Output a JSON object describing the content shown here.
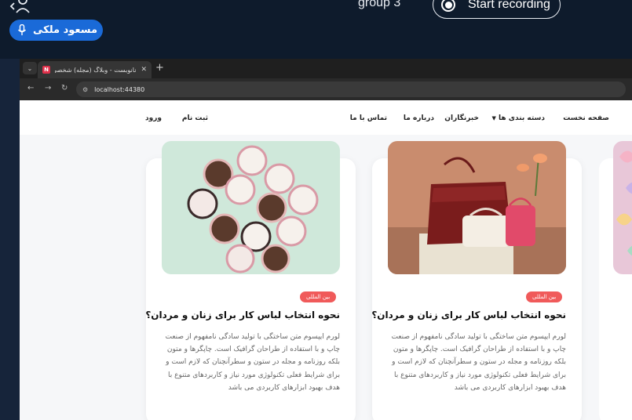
{
  "meet": {
    "group_label": "group 3",
    "record_label": "Start recording",
    "speaker_name": "مسعود ملکی",
    "accent": "#1a6ad8"
  },
  "browser": {
    "tab_title": "نانوبست - وبلاگ (مجله) شخصی",
    "favicon_letter": "N",
    "url": "localhost:44380",
    "icons": [
      "menu-chevron-icon",
      "close-icon",
      "plus-icon",
      "back-icon",
      "forward-icon",
      "reload-icon",
      "site-settings-icon"
    ]
  },
  "site": {
    "nav": {
      "home": "صفحه نخست",
      "categories": "دسته بندی ها",
      "reporters": "خبرنگاران",
      "about": "درباره ما",
      "contact": "تماس با ما",
      "register": "ثبت نام",
      "login": "ورود"
    },
    "cards": [
      {
        "badge": "بین المللی",
        "title": "نحوه انتخاب لباس کار برای زنان و مردان؟",
        "excerpt": "لورم ایپسوم متن ساختگی با تولید سادگی نامفهوم از صنعت چاپ و با استفاده از طراحان گرافیک است. چاپگرها و متون بلکه روزنامه و مجله در ستون و سطرآنچنان که لازم است و برای شرایط فعلی تکنولوژی مورد نیاز و کاربردهای متنوع با هدف بهبود ابزارهای کاربردی می باشد",
        "image": "handbags-photo"
      },
      {
        "badge": "بین المللی",
        "title": "نحوه انتخاب لباس کار برای زنان و مردان؟",
        "excerpt": "لورم ایپسوم متن ساختگی با تولید سادگی نامفهوم از صنعت چاپ و با استفاده از طراحان گرافیک است. چاپگرها و متون بلکه روزنامه و مجله در ستون و سطرآنچنان که لازم است و برای شرایط فعلی تکنولوژی مورد نیاز و کاربردهای متنوع با هدف بهبود ابزارهای کاربردی می باشد",
        "image": "cupcakes-photo"
      }
    ],
    "partial_card": {
      "image": "candy-hearts-photo"
    },
    "badge_color": "#f05a5a"
  }
}
